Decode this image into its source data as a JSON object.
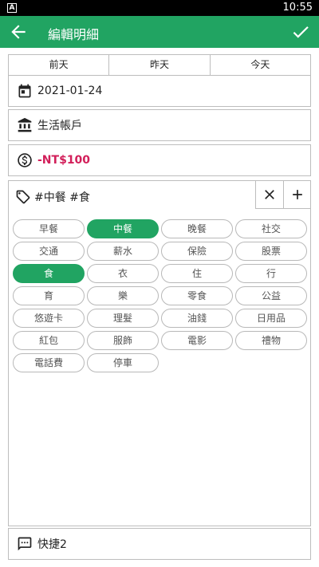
{
  "status_bar": {
    "sim_label": "A",
    "time": "10:55"
  },
  "app_bar": {
    "title": "編輯明細"
  },
  "day_tabs": [
    "前天",
    "昨天",
    "今天"
  ],
  "date": "2021-01-24",
  "account": "生活帳戶",
  "amount": "-NT$100",
  "tags_selected": "#中餐 #食",
  "tags": [
    {
      "label": "早餐",
      "selected": false
    },
    {
      "label": "中餐",
      "selected": true
    },
    {
      "label": "晚餐",
      "selected": false
    },
    {
      "label": "社交",
      "selected": false
    },
    {
      "label": "交通",
      "selected": false
    },
    {
      "label": "薪水",
      "selected": false
    },
    {
      "label": "保險",
      "selected": false
    },
    {
      "label": "股票",
      "selected": false
    },
    {
      "label": "食",
      "selected": true
    },
    {
      "label": "衣",
      "selected": false
    },
    {
      "label": "住",
      "selected": false
    },
    {
      "label": "行",
      "selected": false
    },
    {
      "label": "育",
      "selected": false
    },
    {
      "label": "樂",
      "selected": false
    },
    {
      "label": "零食",
      "selected": false
    },
    {
      "label": "公益",
      "selected": false
    },
    {
      "label": "悠遊卡",
      "selected": false
    },
    {
      "label": "理髮",
      "selected": false
    },
    {
      "label": "油錢",
      "selected": false
    },
    {
      "label": "日用品",
      "selected": false
    },
    {
      "label": "紅包",
      "selected": false
    },
    {
      "label": "服飾",
      "selected": false
    },
    {
      "label": "電影",
      "selected": false
    },
    {
      "label": "禮物",
      "selected": false
    },
    {
      "label": "電話費",
      "selected": false
    },
    {
      "label": "停車",
      "selected": false
    }
  ],
  "quick": "快捷2",
  "colors": {
    "accent": "#21A462",
    "amount": "#D21F5A"
  }
}
